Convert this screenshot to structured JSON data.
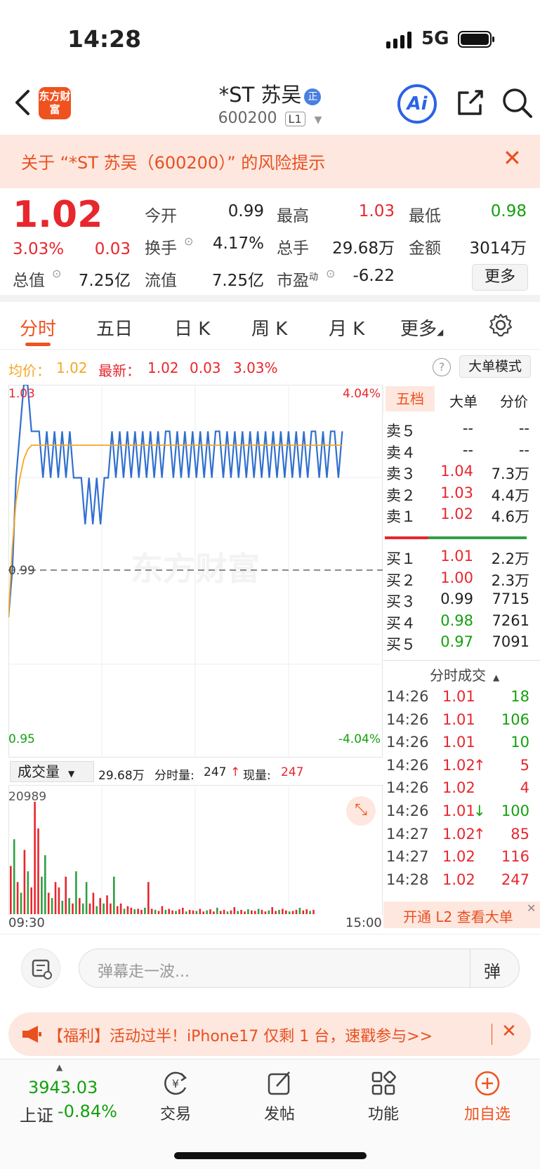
{
  "status_bar": {
    "time": "14:28",
    "network": "5G"
  },
  "header": {
    "logo_text": "东方财富",
    "title": "*ST 苏吴",
    "title_badge": "正",
    "code": "600200",
    "level": "L1",
    "ai_label": "Ai"
  },
  "risk_banner": {
    "text": "关于 “*ST 苏吴（600200）” 的风险提示"
  },
  "quote": {
    "price": "1.02",
    "change_pct": "3.03%",
    "change": "0.03",
    "fields": [
      {
        "label": "今开",
        "value": "0.99"
      },
      {
        "label": "最高",
        "value": "1.03"
      },
      {
        "label": "最低",
        "value": "0.98"
      },
      {
        "label": "换手",
        "value": "4.17%"
      },
      {
        "label": "总手",
        "value": "29.68万"
      },
      {
        "label": "金额",
        "value": "3014万"
      },
      {
        "label": "总值",
        "value": "7.25亿"
      },
      {
        "label": "流值",
        "value": "7.25亿"
      },
      {
        "label": "市盈",
        "label_sup": "动",
        "value": "-6.22"
      }
    ],
    "more_label": "更多"
  },
  "tabs": [
    "分时",
    "五日",
    "日 K",
    "周 K",
    "月 K",
    "更多"
  ],
  "info_line": {
    "avg_label": "均价：",
    "avg_value": "1.02",
    "latest_label": "最新：",
    "latest_value": "1.02",
    "latest_change": "0.03",
    "latest_pct": "3.03%",
    "mode_button": "大单模式"
  },
  "chart_data": {
    "type": "line",
    "watermark": "东方财富",
    "y_labels": {
      "top": "1.03",
      "mid": "0.99",
      "bottom": "0.95",
      "top_pct": "4.04%",
      "bottom_pct": "-4.04%"
    },
    "ylim": [
      0.95,
      1.03
    ],
    "prev_close": 0.99,
    "x_labels": {
      "start": "09:30",
      "end": "15:00"
    },
    "series": [
      {
        "name": "price",
        "color": "#2f6fcf",
        "values": [
          0.98,
          0.99,
          1.01,
          1.02,
          1.03,
          1.03,
          1.02,
          1.02,
          1.02,
          1.01,
          1.02,
          1.01,
          1.02,
          1.01,
          1.02,
          1.01,
          1.02,
          1.01,
          1.01,
          1.01,
          1.0,
          1.01,
          1.0,
          1.01,
          1.0,
          1.01,
          1.01,
          1.02,
          1.01,
          1.02,
          1.01,
          1.02,
          1.01,
          1.02,
          1.01,
          1.02,
          1.01,
          1.02,
          1.01,
          1.02,
          1.01,
          1.02,
          1.02,
          1.01,
          1.02,
          1.01,
          1.02,
          1.01,
          1.02,
          1.01,
          1.02,
          1.01,
          1.02,
          1.01,
          1.02,
          1.02,
          1.01,
          1.02,
          1.01,
          1.02,
          1.01,
          1.02,
          1.01,
          1.02,
          1.01,
          1.02,
          1.01,
          1.02,
          1.01,
          1.02,
          1.01,
          1.02,
          1.01,
          1.02,
          1.01,
          1.02,
          1.01,
          1.02,
          1.01,
          1.02,
          1.02,
          1.01,
          1.02,
          1.01,
          1.02,
          1.02,
          1.01,
          1.02
        ]
      },
      {
        "name": "avg",
        "color": "#f5a623",
        "values": [
          0.98,
          0.995,
          1.005,
          1.01,
          1.014,
          1.016,
          1.017,
          1.017,
          1.017,
          1.017,
          1.017,
          1.017,
          1.017,
          1.017,
          1.017,
          1.017,
          1.017,
          1.017,
          1.017,
          1.017,
          1.017,
          1.017,
          1.017,
          1.017,
          1.017,
          1.017,
          1.017,
          1.017,
          1.017,
          1.017,
          1.017,
          1.017,
          1.017,
          1.017,
          1.017,
          1.017,
          1.017,
          1.017,
          1.017,
          1.017,
          1.017,
          1.017,
          1.017,
          1.017,
          1.017,
          1.017,
          1.017,
          1.017,
          1.017,
          1.017,
          1.017,
          1.017,
          1.017,
          1.017,
          1.017,
          1.017,
          1.017,
          1.017,
          1.017,
          1.017,
          1.017,
          1.017,
          1.017,
          1.017,
          1.017,
          1.017,
          1.017,
          1.017,
          1.017,
          1.017,
          1.017,
          1.017,
          1.017,
          1.017,
          1.017,
          1.017,
          1.017,
          1.017,
          1.017,
          1.017,
          1.017,
          1.017,
          1.017,
          1.017,
          1.017,
          1.017,
          1.017,
          1.017
        ]
      }
    ],
    "total_points": 240
  },
  "volume": {
    "selector": "成交量",
    "total": "29.68万",
    "tick_label": "分时量:",
    "tick_value": "247",
    "now_label": "现量:",
    "now_value": "247",
    "max_label": "20989",
    "max": 20989,
    "bars": [
      [
        9000,
        "r"
      ],
      [
        14000,
        "g"
      ],
      [
        6000,
        "r"
      ],
      [
        4000,
        "g"
      ],
      [
        12000,
        "r"
      ],
      [
        8000,
        "g"
      ],
      [
        5000,
        "r"
      ],
      [
        20989,
        "r"
      ],
      [
        16000,
        "r"
      ],
      [
        7000,
        "g"
      ],
      [
        11000,
        "g"
      ],
      [
        4000,
        "r"
      ],
      [
        3000,
        "g"
      ],
      [
        6000,
        "r"
      ],
      [
        5000,
        "r"
      ],
      [
        2500,
        "g"
      ],
      [
        7000,
        "r"
      ],
      [
        3000,
        "g"
      ],
      [
        2000,
        "r"
      ],
      [
        8000,
        "g"
      ],
      [
        3000,
        "r"
      ],
      [
        2000,
        "g"
      ],
      [
        6000,
        "g"
      ],
      [
        2000,
        "r"
      ],
      [
        4000,
        "r"
      ],
      [
        1500,
        "g"
      ],
      [
        3000,
        "r"
      ],
      [
        2000,
        "g"
      ],
      [
        3500,
        "r"
      ],
      [
        2000,
        "r"
      ],
      [
        7000,
        "g"
      ],
      [
        1500,
        "r"
      ],
      [
        2000,
        "r"
      ],
      [
        1000,
        "g"
      ],
      [
        1500,
        "r"
      ],
      [
        1200,
        "r"
      ],
      [
        900,
        "g"
      ],
      [
        1000,
        "r"
      ],
      [
        800,
        "r"
      ],
      [
        1200,
        "g"
      ],
      [
        6000,
        "r"
      ],
      [
        1000,
        "r"
      ],
      [
        800,
        "g"
      ],
      [
        600,
        "r"
      ],
      [
        1500,
        "r"
      ],
      [
        800,
        "g"
      ],
      [
        1000,
        "r"
      ],
      [
        700,
        "r"
      ],
      [
        600,
        "g"
      ],
      [
        900,
        "r"
      ],
      [
        1200,
        "r"
      ],
      [
        500,
        "g"
      ],
      [
        800,
        "r"
      ],
      [
        700,
        "r"
      ],
      [
        600,
        "g"
      ],
      [
        1000,
        "r"
      ],
      [
        500,
        "r"
      ],
      [
        700,
        "g"
      ],
      [
        900,
        "r"
      ],
      [
        500,
        "r"
      ],
      [
        1200,
        "g"
      ],
      [
        600,
        "r"
      ],
      [
        800,
        "r"
      ],
      [
        500,
        "g"
      ],
      [
        700,
        "r"
      ],
      [
        1300,
        "r"
      ],
      [
        600,
        "g"
      ],
      [
        800,
        "r"
      ],
      [
        500,
        "r"
      ],
      [
        900,
        "g"
      ],
      [
        700,
        "r"
      ],
      [
        600,
        "r"
      ],
      [
        1000,
        "g"
      ],
      [
        800,
        "r"
      ],
      [
        500,
        "r"
      ],
      [
        700,
        "g"
      ],
      [
        1300,
        "r"
      ],
      [
        600,
        "r"
      ],
      [
        800,
        "g"
      ],
      [
        1000,
        "r"
      ],
      [
        700,
        "r"
      ],
      [
        500,
        "g"
      ],
      [
        600,
        "r"
      ],
      [
        800,
        "r"
      ],
      [
        1200,
        "g"
      ],
      [
        700,
        "r"
      ],
      [
        900,
        "r"
      ],
      [
        600,
        "g"
      ],
      [
        800,
        "r"
      ]
    ]
  },
  "order_book": {
    "tabs": [
      "五档",
      "大单",
      "分价"
    ],
    "asks": [
      {
        "label": "卖５",
        "price": "--",
        "vol": "--",
        "color": "#222"
      },
      {
        "label": "卖４",
        "price": "--",
        "vol": "--",
        "color": "#222"
      },
      {
        "label": "卖３",
        "price": "1.04",
        "vol": "7.3万",
        "color": "#e8262d"
      },
      {
        "label": "卖２",
        "price": "1.03",
        "vol": "4.4万",
        "color": "#e8262d"
      },
      {
        "label": "卖１",
        "price": "1.02",
        "vol": "4.6万",
        "color": "#e8262d"
      }
    ],
    "bids": [
      {
        "label": "买１",
        "price": "1.01",
        "vol": "2.2万",
        "color": "#e8262d"
      },
      {
        "label": "买２",
        "price": "1.00",
        "vol": "2.3万",
        "color": "#e8262d"
      },
      {
        "label": "买３",
        "price": "0.99",
        "vol": "7715",
        "color": "#222"
      },
      {
        "label": "买４",
        "price": "0.98",
        "vol": "7261",
        "color": "#13a10e"
      },
      {
        "label": "买５",
        "price": "0.97",
        "vol": "7091",
        "color": "#13a10e"
      }
    ]
  },
  "ticks": {
    "header": "分时成交",
    "rows": [
      {
        "time": "14:26",
        "price": "1.01",
        "arrow": "",
        "vol": "18",
        "vcolor": "#13a10e"
      },
      {
        "time": "14:26",
        "price": "1.01",
        "arrow": "",
        "vol": "106",
        "vcolor": "#13a10e"
      },
      {
        "time": "14:26",
        "price": "1.01",
        "arrow": "",
        "vol": "10",
        "vcolor": "#13a10e"
      },
      {
        "time": "14:26",
        "price": "1.02",
        "arrow": "↑",
        "vol": "5",
        "vcolor": "#e8262d"
      },
      {
        "time": "14:26",
        "price": "1.02",
        "arrow": "",
        "vol": "4",
        "vcolor": "#e8262d"
      },
      {
        "time": "14:26",
        "price": "1.01",
        "arrow": "↓",
        "vol": "100",
        "vcolor": "#13a10e"
      },
      {
        "time": "14:27",
        "price": "1.02",
        "arrow": "↑",
        "vol": "85",
        "vcolor": "#e8262d"
      },
      {
        "time": "14:27",
        "price": "1.02",
        "arrow": "",
        "vol": "116",
        "vcolor": "#e8262d"
      },
      {
        "time": "14:28",
        "price": "1.02",
        "arrow": "",
        "vol": "247",
        "vcolor": "#e8262d"
      }
    ],
    "l2_banner": "开通 L2 查看大单"
  },
  "danmu": {
    "placeholder": "弹幕走一波...",
    "send_label": "弹"
  },
  "promo": {
    "text": "【福利】活动过半！iPhone17 仅剩 1 台，速戳参与>>"
  },
  "bottom_nav": {
    "index_value": "3943.03",
    "index_name": "上证",
    "index_change": "-0.84%",
    "items": [
      "交易",
      "发帖",
      "功能",
      "加自选"
    ]
  },
  "colors": {
    "accent": "#f0521f",
    "up": "#e8262d",
    "down": "#13a10e",
    "price_line": "#2f6fcf",
    "avg_line": "#f5a623"
  }
}
